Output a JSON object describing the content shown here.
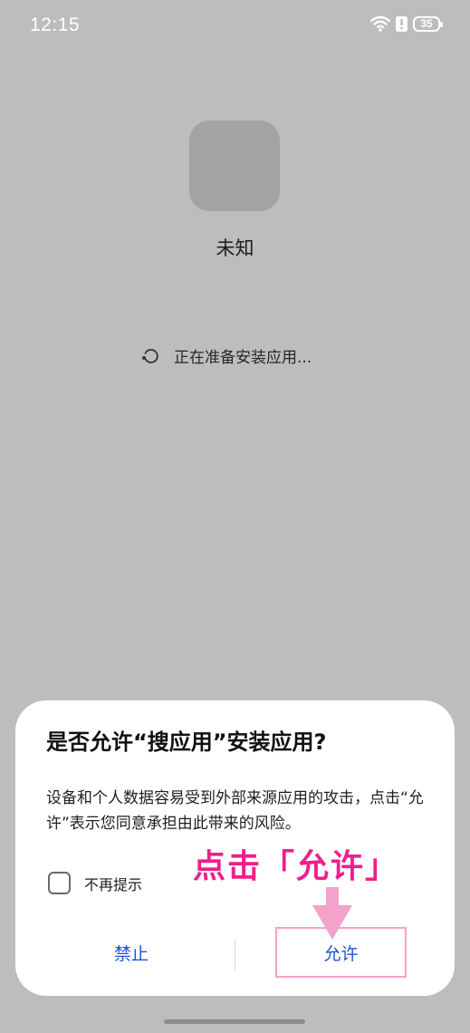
{
  "status_bar": {
    "time": "12:15",
    "battery_level": "35",
    "icons": [
      "wifi-icon",
      "alert-icon",
      "battery-icon"
    ]
  },
  "app": {
    "name": "未知",
    "progress_text": "正在准备安装应用..."
  },
  "dialog": {
    "title": "是否允许“搜应用”安装应用?",
    "message": "设备和个人数据容易受到外部来源应用的攻击，点击“允许”表示您同意承担由此带来的风险。",
    "checkbox_label": "不再提示",
    "checkbox_checked": false,
    "deny_label": "禁止",
    "allow_label": "允许"
  },
  "annotation": {
    "text": "点击「允许」",
    "color": "#ee1f8c"
  },
  "colors": {
    "background": "#bdbdbf",
    "button_text": "#1a55d6",
    "highlight_border": "#f2a2cb",
    "arrow": "#f2a2cb"
  }
}
